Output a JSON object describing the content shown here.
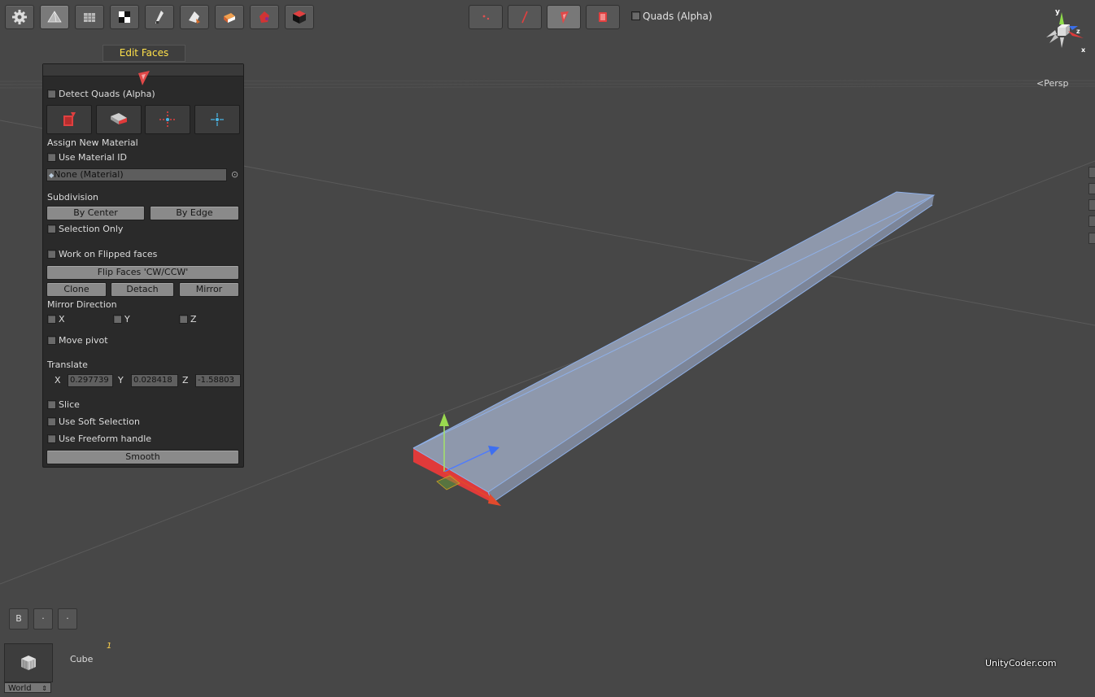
{
  "toolbar": {
    "buttons": [
      {
        "name": "settings-icon"
      },
      {
        "name": "pyramid-mesh-icon"
      },
      {
        "name": "grid-tool-icon"
      },
      {
        "name": "checker-texture-icon"
      },
      {
        "name": "pen-tool-icon"
      },
      {
        "name": "paint-icon"
      },
      {
        "name": "material-icon"
      },
      {
        "name": "vertex-color-icon"
      },
      {
        "name": "cube-object-icon"
      }
    ],
    "modes": [
      {
        "name": "vertex-mode-icon"
      },
      {
        "name": "edge-mode-icon"
      },
      {
        "name": "face-mode-icon"
      },
      {
        "name": "element-mode-icon"
      }
    ],
    "quads_label": "Quads (Alpha)"
  },
  "edit_faces_tab": "Edit Faces",
  "panel": {
    "detect_quads": "Detect Quads (Alpha)",
    "assign_new_material": "Assign New Material",
    "use_material_id": "Use Material ID",
    "material_value": "None (Material)",
    "subdivision": "Subdivision",
    "by_center": "By Center",
    "by_edge": "By Edge",
    "selection_only": "Selection Only",
    "work_on_flipped": "Work on Flipped faces",
    "flip_faces": "Flip Faces 'CW/CCW'",
    "clone": "Clone",
    "detach": "Detach",
    "mirror": "Mirror",
    "mirror_direction": "Mirror Direction",
    "axis_x": "X",
    "axis_y": "Y",
    "axis_z": "Z",
    "move_pivot": "Move pivot",
    "translate": "Translate",
    "tx_label": "X",
    "tx_value": "0.297739",
    "ty_label": "Y",
    "ty_value": "0.028418",
    "tz_label": "Z",
    "tz_value": "-1.58803",
    "slice": "Slice",
    "use_soft_selection": "Use Soft Selection",
    "use_freeform_handle": "Use Freeform handle",
    "smooth": "Smooth"
  },
  "viewport": {
    "persp_label": "Persp",
    "gizmo": {
      "x": "x",
      "y": "y",
      "z": "z"
    }
  },
  "bottom": {
    "btn_b": "B",
    "btn_2": "·",
    "btn_3": "·",
    "object_count": "1",
    "object_name": "Cube",
    "space": "World",
    "watermark": "UnityCoder.com"
  },
  "colors": {
    "accent_yellow": "#ffe14a",
    "face_red": "#e03a3a",
    "mesh_blue": "#7a8bb0"
  }
}
